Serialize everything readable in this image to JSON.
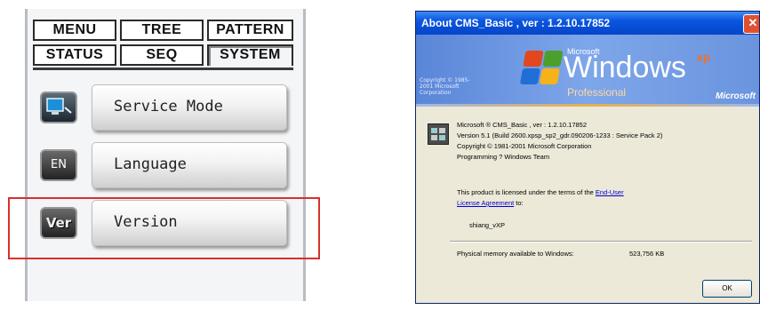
{
  "tabs": [
    {
      "label": "MENU"
    },
    {
      "label": "TREE"
    },
    {
      "label": "PATTERN"
    },
    {
      "label": "STATUS"
    },
    {
      "label": "SEQ"
    },
    {
      "label": "SYSTEM",
      "active": true
    }
  ],
  "menu": [
    {
      "label": "Service Mode",
      "icon": "monitor-icon",
      "icon_text": ""
    },
    {
      "label": "Language",
      "icon": "language-icon",
      "icon_text": "EN"
    },
    {
      "label": "Version",
      "icon": "version-icon",
      "icon_text": "Ver",
      "highlighted": true
    }
  ],
  "dialog": {
    "title": "About CMS_Basic , ver : 1.2.10.17852",
    "banner": {
      "microsoft": "Microsoft",
      "windows": "Windows",
      "xp": "xp",
      "edition": "Professional",
      "copyright": "Copyright © 1985-2001 Microsoft Corporation",
      "brand": "Microsoft"
    },
    "info_lines": [
      "Microsoft ® CMS_Basic , ver : 1.2.10.17852",
      "Version 5.1 (Build 2600.xpsp_sp2_gdr.090206-1233 : Service Pack 2)",
      "Copyright © 1981-2001 Microsoft Corporation",
      "Programming ? Windows Team"
    ],
    "license_text": "This product is licensed under the terms of the",
    "license_link_1": "End-User",
    "license_link_2": "License Agreement",
    "license_suffix": " to:",
    "licensed_user": "shiang_vXP",
    "memory_label": "Physical memory available to Windows:",
    "memory_value": "523,756 KB",
    "ok_label": "OK"
  },
  "colors": {
    "highlight": "#d9302c",
    "xp_title": "#0a55e0",
    "dialog_bg": "#ece9d8"
  }
}
